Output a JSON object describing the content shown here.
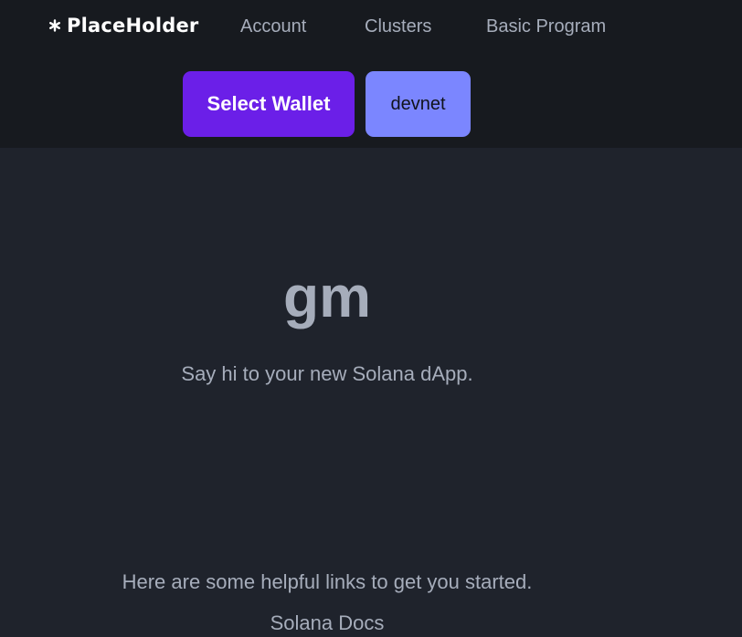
{
  "header": {
    "brand": "PlaceHolder",
    "logo_icon": "sparkle-icon",
    "nav": {
      "account": "Account",
      "clusters": "Clusters",
      "basic_program": "Basic Program"
    },
    "wallet_button": "Select Wallet",
    "cluster_button": "devnet"
  },
  "hero": {
    "title": "gm",
    "subtitle": "Say hi to your new Solana dApp."
  },
  "links": {
    "intro": "Here are some helpful links to get you started.",
    "items": [
      "Solana Docs"
    ]
  },
  "colors": {
    "navbar_bg": "#171a1f",
    "page_bg": "#1f232c",
    "wallet_button": "#6b1fe8",
    "cluster_button": "#7b86ff",
    "text_muted": "#a6adbb"
  }
}
